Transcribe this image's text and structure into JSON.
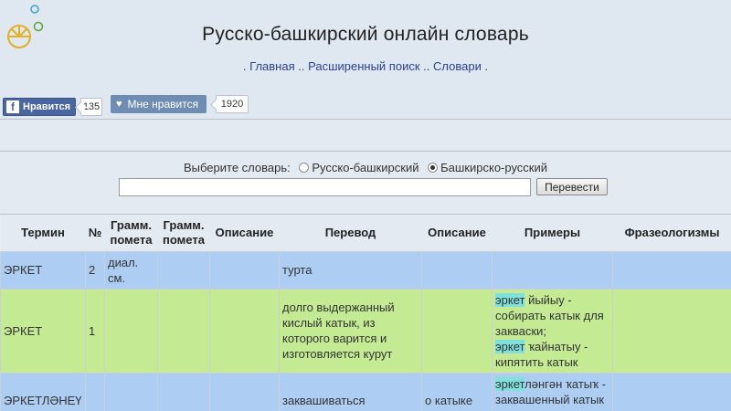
{
  "header": {
    "title": "Русско-башкирский онлайн словарь",
    "nav": [
      {
        "label": "Главная"
      },
      {
        "label": "Расширенный поиск"
      },
      {
        "label": "Словари"
      }
    ],
    "nav_lead": ".",
    "nav_sep": "..",
    "nav_trail": "."
  },
  "social": {
    "fb_label": "Нравится",
    "fb_count": "135",
    "vk_label": "Мне нравится",
    "vk_count": "1920"
  },
  "search": {
    "choose_label": "Выберите словарь:",
    "options": [
      {
        "label": "Русско-башкирский",
        "selected": false
      },
      {
        "label": "Башкирско-русский",
        "selected": true
      }
    ],
    "input_value": "",
    "button_label": "Перевести"
  },
  "table": {
    "headers": [
      "Термин",
      "№",
      "Грамм. помета",
      "Грамм. помета",
      "Описание",
      "Перевод",
      "Описание",
      "Примеры",
      "Фразеологизмы"
    ],
    "rows": [
      {
        "term": "ЭРКЕТ",
        "num": "2",
        "gram1": "диал. см.",
        "gram2": "",
        "desc1": "",
        "translation": "турта",
        "desc2": "",
        "examples": [],
        "phraseology": ""
      },
      {
        "term": "ЭРКЕТ",
        "num": "1",
        "gram1": "",
        "gram2": "",
        "desc1": "",
        "translation": "долго выдержанный кислый катык, из которого варится и изготовляется курут",
        "desc2": "",
        "examples": [
          {
            "hl": "эркет",
            "rest": " йыйыу - собирать катык для закваски;"
          },
          {
            "hl": "эркет",
            "rest": " ҡайнатыу - кипятить катык"
          }
        ],
        "phraseology": ""
      },
      {
        "term": "ЭРКЕТЛӘНЕҮ",
        "num": "",
        "gram1": "",
        "gram2": "",
        "desc1": "",
        "translation": "заквашиваться",
        "desc2": "о катыке",
        "examples": [
          {
            "hl": "эркет",
            "rest": "ләнгән ҡатыҡ - заквашенный катык"
          }
        ],
        "phraseology": ""
      }
    ]
  },
  "colors": {
    "row_blue": "#aecdf3",
    "row_green": "#c4eb94",
    "highlight": "#7fe0dc",
    "fb": "#4a66a0",
    "vk": "#6f8db3"
  }
}
